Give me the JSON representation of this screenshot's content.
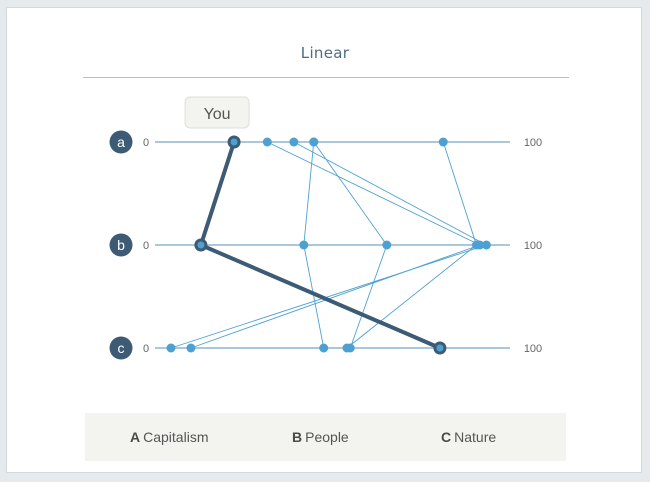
{
  "title": "Linear",
  "chart_data": {
    "type": "parallel-coordinates",
    "axes": [
      {
        "badge": "a",
        "min_label": "0",
        "max_label": "100"
      },
      {
        "badge": "b",
        "min_label": "0",
        "max_label": "100"
      },
      {
        "badge": "c",
        "min_label": "0",
        "max_label": "100"
      }
    ],
    "range": [
      0,
      100
    ],
    "series": [
      {
        "values": [
          19,
          9,
          81
        ],
        "highlight": true,
        "label": "You"
      },
      {
        "values": [
          29,
          93,
          6
        ]
      },
      {
        "values": [
          37,
          95,
          0
        ]
      },
      {
        "values": [
          43,
          40,
          46
        ]
      },
      {
        "values": [
          82,
          92,
          53
        ]
      },
      {
        "values": [
          43,
          65,
          54
        ]
      }
    ],
    "colors": {
      "line": "#4da1d1",
      "highlight": "#3d5b75",
      "badge": "#3d5b75"
    }
  },
  "legend": [
    {
      "key": "A",
      "label": "Capitalism"
    },
    {
      "key": "B",
      "label": "People"
    },
    {
      "key": "C",
      "label": "Nature"
    }
  ]
}
